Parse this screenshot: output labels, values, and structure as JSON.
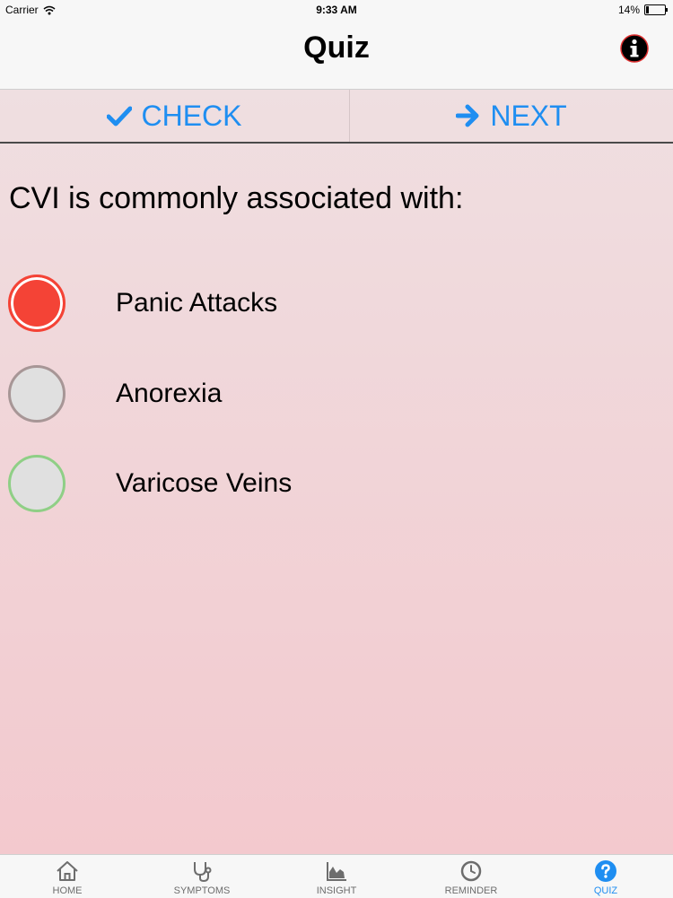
{
  "status": {
    "carrier": "Carrier",
    "time": "9:33 AM",
    "battery": "14%",
    "battery_level": 0.14
  },
  "header": {
    "title": "Quiz",
    "info_icon": "info-icon"
  },
  "actions": {
    "check": "CHECK",
    "next": "NEXT"
  },
  "quiz": {
    "question": "CVI is commonly associated with:",
    "options": [
      {
        "label": "Panic Attacks",
        "state": "selected",
        "color": "#f44336"
      },
      {
        "label": "Anorexia",
        "state": "unselected",
        "color": "#a79696"
      },
      {
        "label": "Varicose Veins",
        "state": "unselected",
        "color": "#8fcf86"
      }
    ]
  },
  "tabs": [
    {
      "label": "HOME",
      "icon": "home-icon"
    },
    {
      "label": "SYMPTOMS",
      "icon": "stethoscope-icon"
    },
    {
      "label": "INSIGHT",
      "icon": "chart-icon"
    },
    {
      "label": "REMINDER",
      "icon": "clock-icon"
    },
    {
      "label": "QUIZ",
      "icon": "question-icon",
      "active": true
    }
  ],
  "colors": {
    "accent": "#1f8ef1",
    "selected": "#f44336"
  }
}
